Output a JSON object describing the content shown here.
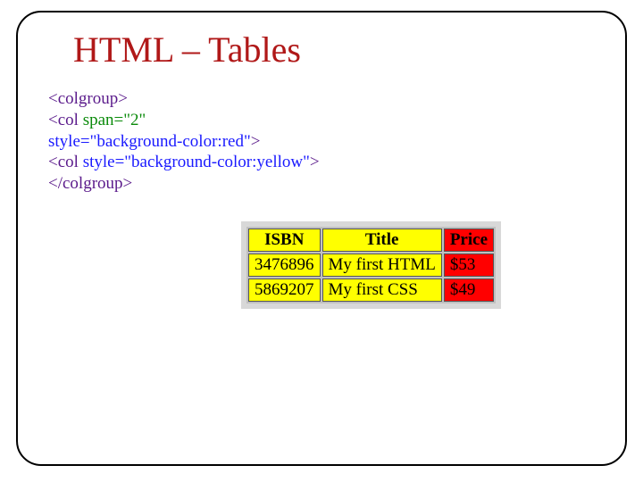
{
  "title": "HTML – Tables",
  "code": {
    "l1_open": "<colgroup>",
    "l2_indent": "    ",
    "l2_tag_open": "<col  ",
    "l2_attr": "span=\"2\"",
    "l3_style": "style=\"background-color:red\"",
    "l3_close": ">",
    "l4_indent": "    ",
    "l4_tag_open": "<col  ",
    "l4_style": "style=\"background-color:yellow\"",
    "l4_close": ">",
    "l5_close": "</colgroup>"
  },
  "chart_data": {
    "type": "table",
    "columns": [
      "ISBN",
      "Title",
      "Price"
    ],
    "column_backgrounds": [
      "yellow",
      "yellow",
      "red"
    ],
    "rows": [
      {
        "isbn": "3476896",
        "title": "My first HTML",
        "price": "$53"
      },
      {
        "isbn": "5869207",
        "title": "My first CSS",
        "price": "$49"
      }
    ]
  }
}
